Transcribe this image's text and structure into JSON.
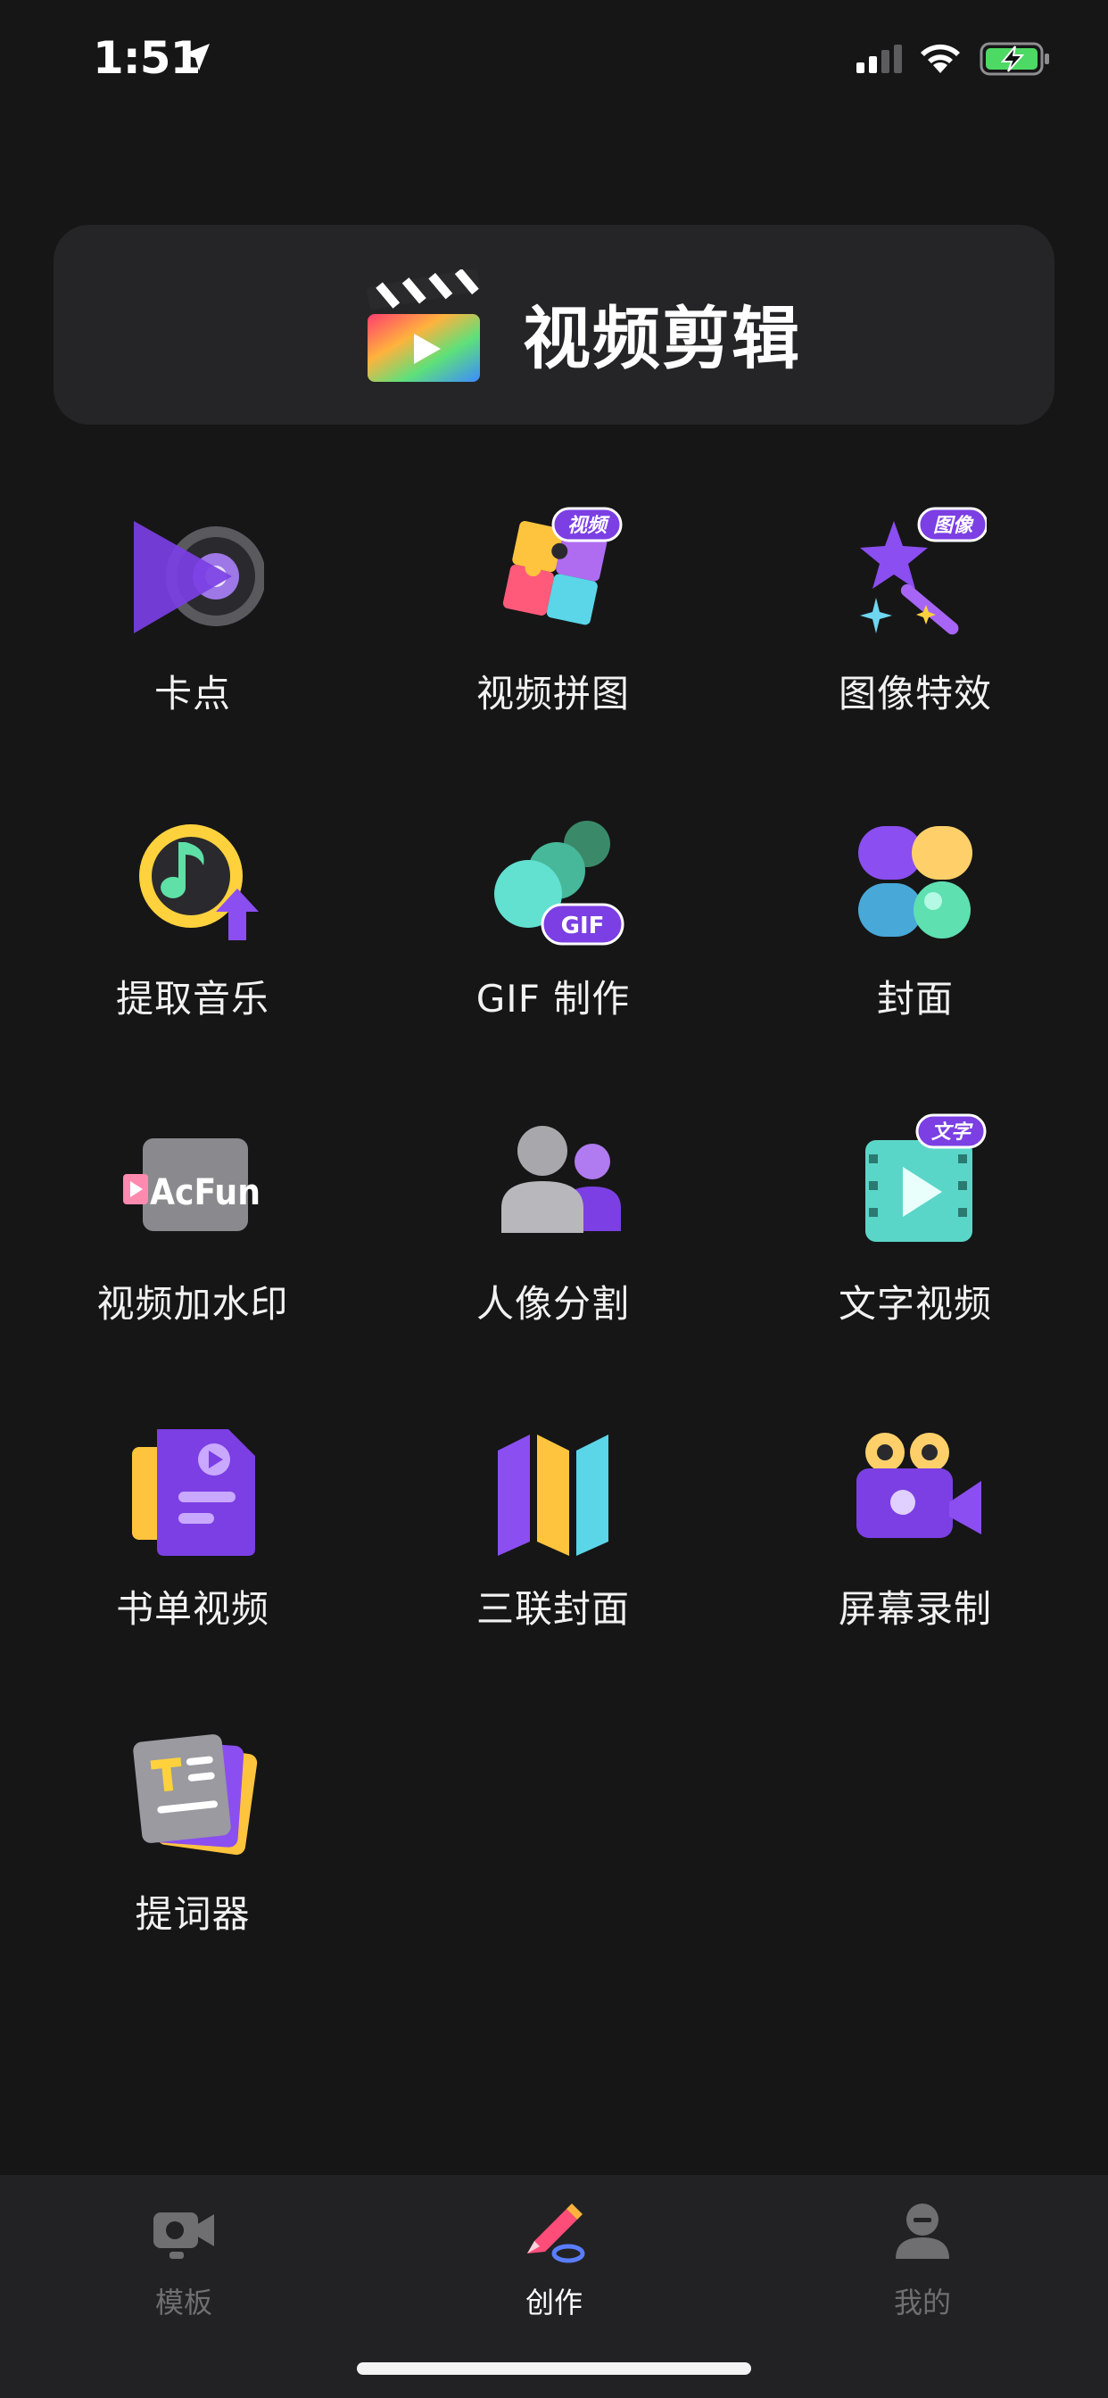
{
  "status_bar": {
    "time": "1:51"
  },
  "header": {
    "title": "视频剪辑"
  },
  "tools": [
    {
      "label": "卡点",
      "icon": "beat-sync-icon"
    },
    {
      "label": "视频拼图",
      "icon": "video-collage-icon",
      "badge": "视频"
    },
    {
      "label": "图像特效",
      "icon": "image-effects-icon",
      "badge": "图像"
    },
    {
      "label": "提取音乐",
      "icon": "extract-music-icon"
    },
    {
      "label": "GIF 制作",
      "icon": "gif-maker-icon",
      "badge": "GIF"
    },
    {
      "label": "封面",
      "icon": "cover-icon"
    },
    {
      "label": "视频加水印",
      "icon": "watermark-icon",
      "badge": "AcFun"
    },
    {
      "label": "人像分割",
      "icon": "portrait-segmentation-icon"
    },
    {
      "label": "文字视频",
      "icon": "text-video-icon",
      "badge": "文字"
    },
    {
      "label": "书单视频",
      "icon": "booklist-video-icon"
    },
    {
      "label": "三联封面",
      "icon": "triptych-cover-icon"
    },
    {
      "label": "屏幕录制",
      "icon": "screen-record-icon"
    },
    {
      "label": "提词器",
      "icon": "teleprompter-icon"
    }
  ],
  "bottom_nav": [
    {
      "label": "模板",
      "icon": "template-camera-icon",
      "active": false
    },
    {
      "label": "创作",
      "icon": "create-pencil-icon",
      "active": true
    },
    {
      "label": "我的",
      "icon": "profile-icon",
      "active": false
    }
  ],
  "colors": {
    "background": "#161617",
    "card": "#252527",
    "accent_purple": "#7b3fe4",
    "inactive_nav": "#6f6f72"
  }
}
